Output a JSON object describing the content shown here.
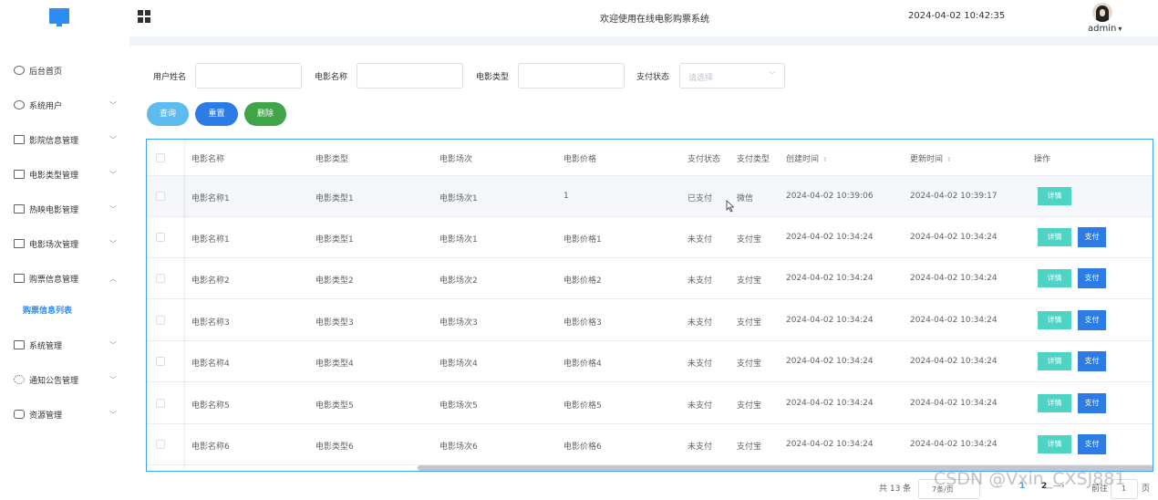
{
  "header": {
    "title": "欢迎使用在线电影购票系统",
    "datetime": "2024-04-02 10:42:35",
    "username": "admin",
    "user_caret": "▾"
  },
  "sidebar": {
    "items": [
      {
        "label": "后台首页",
        "icon": "clock-icon",
        "has_arrow": false
      },
      {
        "label": "系统用户",
        "icon": "user-icon",
        "has_arrow": true
      },
      {
        "label": "影院信息管理",
        "icon": "list-icon",
        "has_arrow": true
      },
      {
        "label": "电影类型管理",
        "icon": "list-icon",
        "has_arrow": true
      },
      {
        "label": "热映电影管理",
        "icon": "list-icon",
        "has_arrow": true
      },
      {
        "label": "电影场次管理",
        "icon": "list-icon",
        "has_arrow": true
      },
      {
        "label": "购票信息管理",
        "icon": "list-icon",
        "has_arrow": true,
        "expanded": true
      },
      {
        "label": "系统管理",
        "icon": "folder-icon",
        "has_arrow": true
      },
      {
        "label": "通知公告管理",
        "icon": "spinner-icon",
        "has_arrow": true
      },
      {
        "label": "资源管理",
        "icon": "tag-icon",
        "has_arrow": true
      }
    ],
    "submenu_active": "购票信息列表"
  },
  "filters": {
    "user_name_label": "用户姓名",
    "movie_name_label": "电影名称",
    "movie_type_label": "电影类型",
    "pay_status_label": "支付状态",
    "pay_status_placeholder": "请选择",
    "user_name_value": "",
    "movie_name_value": "",
    "movie_type_value": ""
  },
  "actions": {
    "query": "查询",
    "reset": "重置",
    "delete": "删除"
  },
  "colors": {
    "query": "#5cbcf0",
    "reset": "#2d7be5",
    "delete": "#3fa548",
    "detail": "#4fd3c4",
    "pay": "#2d7be5",
    "accent": "#409eff"
  },
  "table": {
    "headers": {
      "name": "电影名称",
      "type": "电影类型",
      "session": "电影场次",
      "price": "电影价格",
      "status": "支付状态",
      "paytype": "支付类型",
      "created": "创建时间",
      "updated": "更新时间",
      "ops": "操作"
    },
    "detail_label": "详情",
    "pay_label": "支付",
    "rows": [
      {
        "name": "电影名称1",
        "type": "电影类型1",
        "session": "电影场次1",
        "price": "1",
        "status": "已支付",
        "paytype": "微信",
        "created": "2024-04-02 10:39:06",
        "updated": "2024-04-02 10:39:17",
        "show_pay": false
      },
      {
        "name": "电影名称1",
        "type": "电影类型1",
        "session": "电影场次1",
        "price": "电影价格1",
        "status": "未支付",
        "paytype": "支付宝",
        "created": "2024-04-02 10:34:24",
        "updated": "2024-04-02 10:34:24",
        "show_pay": true
      },
      {
        "name": "电影名称2",
        "type": "电影类型2",
        "session": "电影场次2",
        "price": "电影价格2",
        "status": "未支付",
        "paytype": "支付宝",
        "created": "2024-04-02 10:34:24",
        "updated": "2024-04-02 10:34:24",
        "show_pay": true
      },
      {
        "name": "电影名称3",
        "type": "电影类型3",
        "session": "电影场次3",
        "price": "电影价格3",
        "status": "未支付",
        "paytype": "支付宝",
        "created": "2024-04-02 10:34:24",
        "updated": "2024-04-02 10:34:24",
        "show_pay": true
      },
      {
        "name": "电影名称4",
        "type": "电影类型4",
        "session": "电影场次4",
        "price": "电影价格4",
        "status": "未支付",
        "paytype": "支付宝",
        "created": "2024-04-02 10:34:24",
        "updated": "2024-04-02 10:34:24",
        "show_pay": true
      },
      {
        "name": "电影名称5",
        "type": "电影类型5",
        "session": "电影场次5",
        "price": "电影价格5",
        "status": "未支付",
        "paytype": "支付宝",
        "created": "2024-04-02 10:34:24",
        "updated": "2024-04-02 10:34:24",
        "show_pay": true
      },
      {
        "name": "电影名称6",
        "type": "电影类型6",
        "session": "电影场次6",
        "price": "电影价格6",
        "status": "未支付",
        "paytype": "支付宝",
        "created": "2024-04-02 10:34:24",
        "updated": "2024-04-02 10:34:24",
        "show_pay": true
      }
    ]
  },
  "pagination": {
    "total": "共 13 条",
    "page_size": "7条/页",
    "prev": "‹",
    "page1": "1",
    "page2": "2",
    "next": "—›",
    "goto": "前往",
    "goto_value": "1",
    "page_unit": "页"
  },
  "watermark": "CSDN @Vxin_CXSJ881"
}
